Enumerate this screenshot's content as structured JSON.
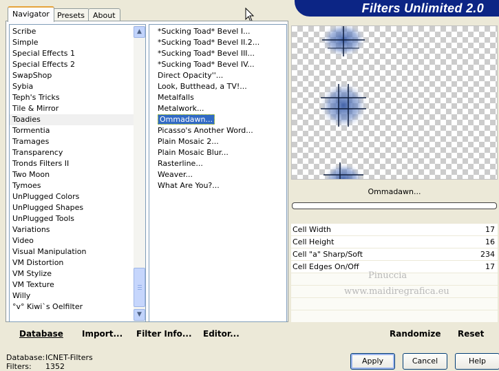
{
  "title": "Filters Unlimited 2.0",
  "tabs": [
    {
      "label": "Navigator"
    },
    {
      "label": "Presets"
    },
    {
      "label": "About"
    }
  ],
  "categories": [
    "Scribe",
    "Simple",
    "Special Effects 1",
    "Special Effects 2",
    "SwapShop",
    "Sybia",
    "Teph's Tricks",
    "Tile & Mirror",
    "Toadies",
    "Tormentia",
    "Tramages",
    "Transparency",
    "Tronds Filters II",
    "Two Moon",
    "Tymoes",
    "UnPlugged Colors",
    "UnPlugged Shapes",
    "UnPlugged Tools",
    "Variations",
    "Video",
    "Visual Manipulation",
    "VM Distortion",
    "VM Stylize",
    "VM Texture",
    "Willy",
    "°v° Kiwi`s Oelfilter"
  ],
  "selected_category": "Toadies",
  "filters": [
    "*Sucking Toad*  Bevel I...",
    "*Sucking Toad*  Bevel II.2...",
    "*Sucking Toad*  Bevel III...",
    "*Sucking Toad*  Bevel IV...",
    "Direct Opacity''...",
    "Look, Butthead, a TV!...",
    "Metalfalls",
    "Metalwork...",
    "Ommadawn...",
    "Picasso's Another Word...",
    "Plain Mosaic 2...",
    "Plain Mosaic Blur...",
    "Rasterline...",
    "Weaver...",
    "What Are You?..."
  ],
  "selected_filter": "Ommadawn...",
  "current_filter_name": "Ommadawn...",
  "progress": 0,
  "parameters": [
    {
      "label": "Cell Width",
      "value": "17"
    },
    {
      "label": "Cell Height",
      "value": "16"
    },
    {
      "label": "Cell \"a\" Sharp/Soft",
      "value": "234"
    },
    {
      "label": "Cell Edges On/Off",
      "value": "17"
    }
  ],
  "watermark": {
    "line1": "Pinuccia",
    "line2": "www.maidiregrafica.eu"
  },
  "toolbar": {
    "database": "Database",
    "import": "Import...",
    "filter_info": "Filter Info...",
    "editor": "Editor...",
    "randomize": "Randomize",
    "reset": "Reset"
  },
  "status": {
    "database_label": "Database:",
    "database_value": "ICNET-Filters",
    "filters_label": "Filters:",
    "filters_value": "1352"
  },
  "buttons": {
    "apply": "Apply",
    "cancel": "Cancel",
    "help": "Help"
  },
  "colors": {
    "banner": "#0c2585",
    "selection": "#316ac5",
    "preview_cell": "#2b4a8a"
  }
}
